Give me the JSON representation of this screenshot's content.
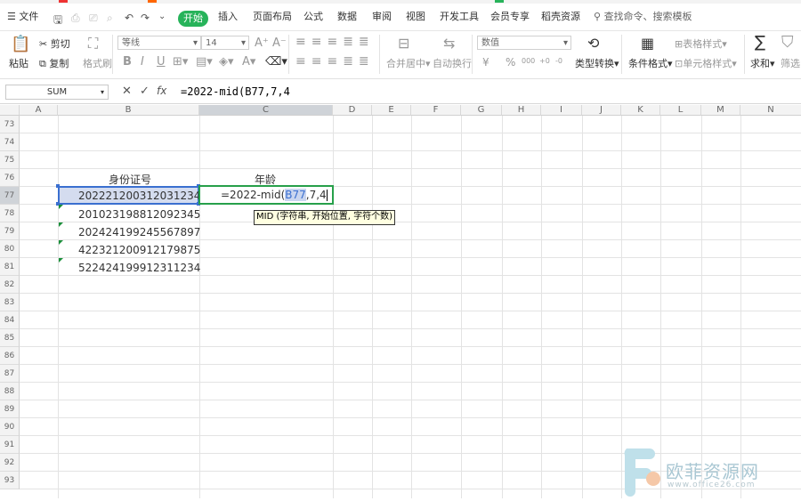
{
  "menubar": {
    "file_label": "文件",
    "active_tab": "开始",
    "tabs": [
      "插入",
      "页面布局",
      "公式",
      "数据",
      "审阅",
      "视图",
      "开发工具",
      "会员专享",
      "稻壳资源"
    ],
    "search_placeholder": "查找命令、搜索模板"
  },
  "ribbon": {
    "paste": "粘贴",
    "cut": "剪切",
    "copy": "复制",
    "format_painter": "格式刷",
    "font_name": "等线",
    "font_size": "14",
    "bold": "B",
    "italic": "I",
    "underline": "U",
    "merge_center": "合并居中",
    "auto_wrap": "自动换行",
    "number_format": "数值",
    "currency": "¥",
    "percent": "%",
    "thousands": "000",
    "dec_inc": "+0",
    "dec_dec": "-0",
    "type_convert": "类型转换",
    "conditional_format": "条件格式",
    "table_style": "表格样式",
    "cell_style": "单元格样式",
    "sum": "求和",
    "filter": "筛选"
  },
  "formula_bar": {
    "name_box": "SUM",
    "fx": "fx",
    "formula": "=2022-mid(B77,7,4"
  },
  "grid": {
    "columns": [
      "A",
      "B",
      "C",
      "D",
      "E",
      "F",
      "G",
      "H",
      "I",
      "J",
      "K",
      "L",
      "M",
      "N"
    ],
    "rows": [
      "73",
      "74",
      "75",
      "76",
      "77",
      "78",
      "79",
      "80",
      "81",
      "82",
      "83",
      "84",
      "85",
      "86",
      "87",
      "88",
      "89",
      "90",
      "91",
      "92",
      "93"
    ],
    "header_id": "身份证号",
    "header_age": "年龄",
    "ids": [
      "202221200312031234",
      "201023198812092345",
      "202424199245567897",
      "422321200912179875",
      "522424199912311234"
    ],
    "editing_prefix": "=2022-mid(",
    "editing_ref": "B77",
    "editing_suffix": ",7,4",
    "tooltip": "MID (字符串, 开始位置, 字符个数)"
  },
  "watermark": {
    "title": "欧菲资源网",
    "url": "www.office26.com"
  }
}
